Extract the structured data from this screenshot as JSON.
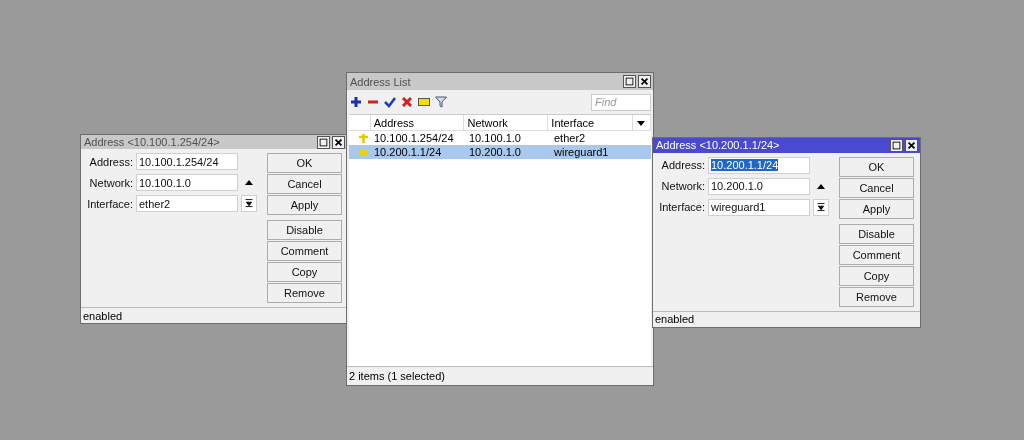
{
  "windows": [
    {
      "kind": "dialog",
      "title": "Address <10.100.1.254/24>",
      "active": false,
      "fields": [
        {
          "kind": "text",
          "label": "Address:",
          "value": "10.100.1.254/24",
          "highlighted": false
        },
        {
          "kind": "collapse",
          "label": "Network:",
          "value": "10.100.1.0",
          "highlighted": false
        },
        {
          "kind": "select",
          "label": "Interface:",
          "value": "ether2",
          "highlighted": false
        }
      ],
      "buttons": [
        [
          "OK",
          "Cancel",
          "Apply"
        ],
        [
          "Disable",
          "Comment",
          "Copy",
          "Remove"
        ]
      ],
      "status": "enabled"
    },
    {
      "kind": "list",
      "title": "Address List",
      "active": false,
      "find_placeholder": "Find",
      "columns": [
        "Address",
        "Network",
        "Interface"
      ],
      "rows": [
        {
          "kind": "dynamic",
          "cells": [
            "10.100.1.254/24",
            "10.100.1.0",
            "ether2"
          ],
          "selected": false
        },
        {
          "kind": "static",
          "cells": [
            "10.200.1.1/24",
            "10.200.1.0",
            "wireguard1"
          ],
          "selected": true
        }
      ],
      "status": "2 items (1 selected)"
    },
    {
      "kind": "dialog",
      "title": "Address <10.200.1.1/24>",
      "active": true,
      "fields": [
        {
          "kind": "text",
          "label": "Address:",
          "value": "10.200.1.1/24",
          "highlighted": true
        },
        {
          "kind": "collapse",
          "label": "Network:",
          "value": "10.200.1.0",
          "highlighted": false
        },
        {
          "kind": "select",
          "label": "Interface:",
          "value": "wireguard1",
          "highlighted": false
        }
      ],
      "buttons": [
        [
          "OK",
          "Cancel",
          "Apply"
        ],
        [
          "Disable",
          "Comment",
          "Copy",
          "Remove"
        ]
      ],
      "status": "enabled"
    }
  ]
}
